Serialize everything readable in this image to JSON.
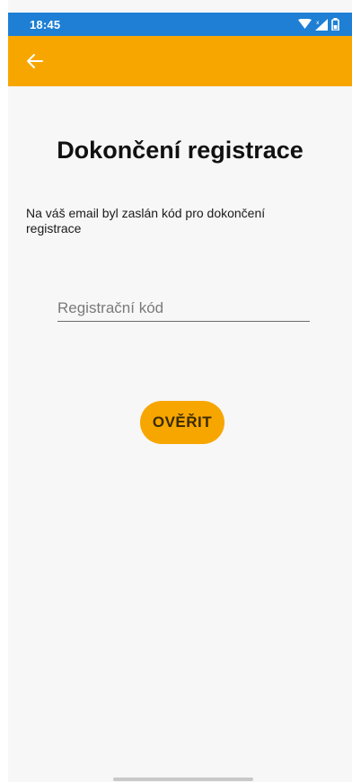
{
  "status_bar": {
    "time": "18:45",
    "icons": [
      "wifi-icon",
      "signal-icon",
      "battery-icon"
    ],
    "background": "#1e7fd4"
  },
  "app_bar": {
    "back_icon": "arrow-left-icon",
    "background": "#f7a600"
  },
  "page": {
    "title": "Dokončení registrace",
    "message": "Na váš email byl zaslán kód pro dokončení registrace"
  },
  "form": {
    "code_field": {
      "value": "",
      "placeholder": "Registrační kód"
    },
    "verify_button": {
      "label": "OVĚŘIT",
      "color": "#f7a600"
    }
  }
}
